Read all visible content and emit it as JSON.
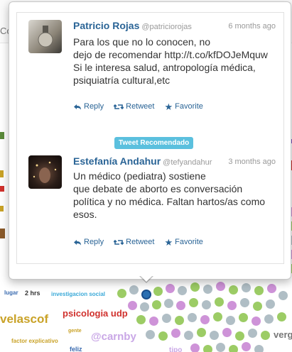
{
  "background": {
    "partial_text": "Co",
    "words": [
      {
        "text": "velascof",
        "color": "#c9a227"
      },
      {
        "text": "psicologia udp",
        "color": "#d0312d"
      },
      {
        "text": "@carnby",
        "color": "#c9a7e6"
      },
      {
        "text": "investigacion social",
        "color": "#3aa9d8"
      },
      {
        "text": "2 hrs",
        "color": "#333333"
      },
      {
        "text": "lugar",
        "color": "#3a6bb0"
      },
      {
        "text": "factor explicativo",
        "color": "#c9a227"
      },
      {
        "text": "gente",
        "color": "#c9a227"
      },
      {
        "text": "feliz",
        "color": "#3a6bb0"
      },
      {
        "text": "verg",
        "color": "#666666"
      },
      {
        "text": "tipo",
        "color": "#c9a7e6"
      }
    ]
  },
  "tweets": [
    {
      "name": "Patricio Rojas",
      "handle": "@patriciorojas",
      "time": "6 months ago",
      "lines": [
        "Para los que no lo conocen, no",
        "dejo de recomendar http://t.co/kfDOJeMquw",
        "Si le interesa salud, antropología médica,",
        "psiquiatría cultural,etc"
      ]
    },
    {
      "name": "Estefanía Andahur",
      "handle": "@tefyandahur",
      "time": "3 months ago",
      "badge": "Tweet Recomendado",
      "lines": [
        "Un médico (pediatra) sostiene",
        "que debate de aborto es conversación",
        "política y no médica. Faltan hartos/as como",
        "esos."
      ]
    }
  ],
  "actions": {
    "reply": "Reply",
    "retweet": "Retweet",
    "favorite": "Favorite"
  },
  "colors": {
    "link": "#2a6496",
    "badge": "#5bc0de",
    "muted": "#999999"
  },
  "icons": [
    "reply-icon",
    "retweet-icon",
    "star-icon"
  ]
}
